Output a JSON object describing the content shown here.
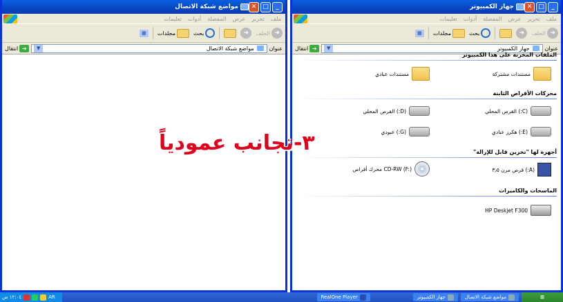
{
  "left_window": {
    "title": "مواضع شبكة الاتصال",
    "menu": [
      "ملف",
      "تحرير",
      "عرض",
      "المفضلة",
      "أدوات",
      "تعليمات"
    ],
    "toolbar": {
      "back": "الخلف",
      "search": "بحث",
      "folders": "مجلدات"
    },
    "address_label": "عنوان",
    "address_value": "مواضع شبكة الاتصال",
    "go_label": "انتقال"
  },
  "right_window": {
    "title": "جهاز الكمبيوتر",
    "menu": [
      "ملف",
      "تحرير",
      "عرض",
      "المفضلة",
      "أدوات",
      "تعليمات"
    ],
    "toolbar": {
      "back": "الخلف",
      "search": "بحث",
      "folders": "مجلدات"
    },
    "address_label": "عنوان",
    "address_value": "جهاز الكمبيوتر",
    "go_label": "انتقال",
    "sections": {
      "stored_files": "الملفات المخزنة على هذا الكمبيوتر",
      "hard_drives": "محركات الأقراص الثابتة",
      "removable": "أجهزة لها \"تخزين قابل للإزالة\"",
      "scanners": "الماسحات والكاميرات"
    },
    "items": {
      "shared_docs": "مستندات مشتركة",
      "user_docs": "مستندات عبادي",
      "drive_c": "(C:) القرص المحلي",
      "drive_d": "(D:) القرص المحلي",
      "drive_e": "(E:) هكرز عبادي",
      "drive_g": "(G:) عبودي",
      "floppy": "(A:) قرص مرن ٣٫٥",
      "cdrw": "CD-RW (F:) محرك أقراص",
      "printer": "HP Deskjet F300"
    }
  },
  "overlay_text": "٣-تجانب عمودياً",
  "taskbar": {
    "clock": "١٢:٠٤ ص",
    "lang": "AR",
    "task_realone": "RealOne Player",
    "task_computer": "جهاز الكمبيوتر",
    "task_network": "مواضع شبكة الاتصال"
  }
}
